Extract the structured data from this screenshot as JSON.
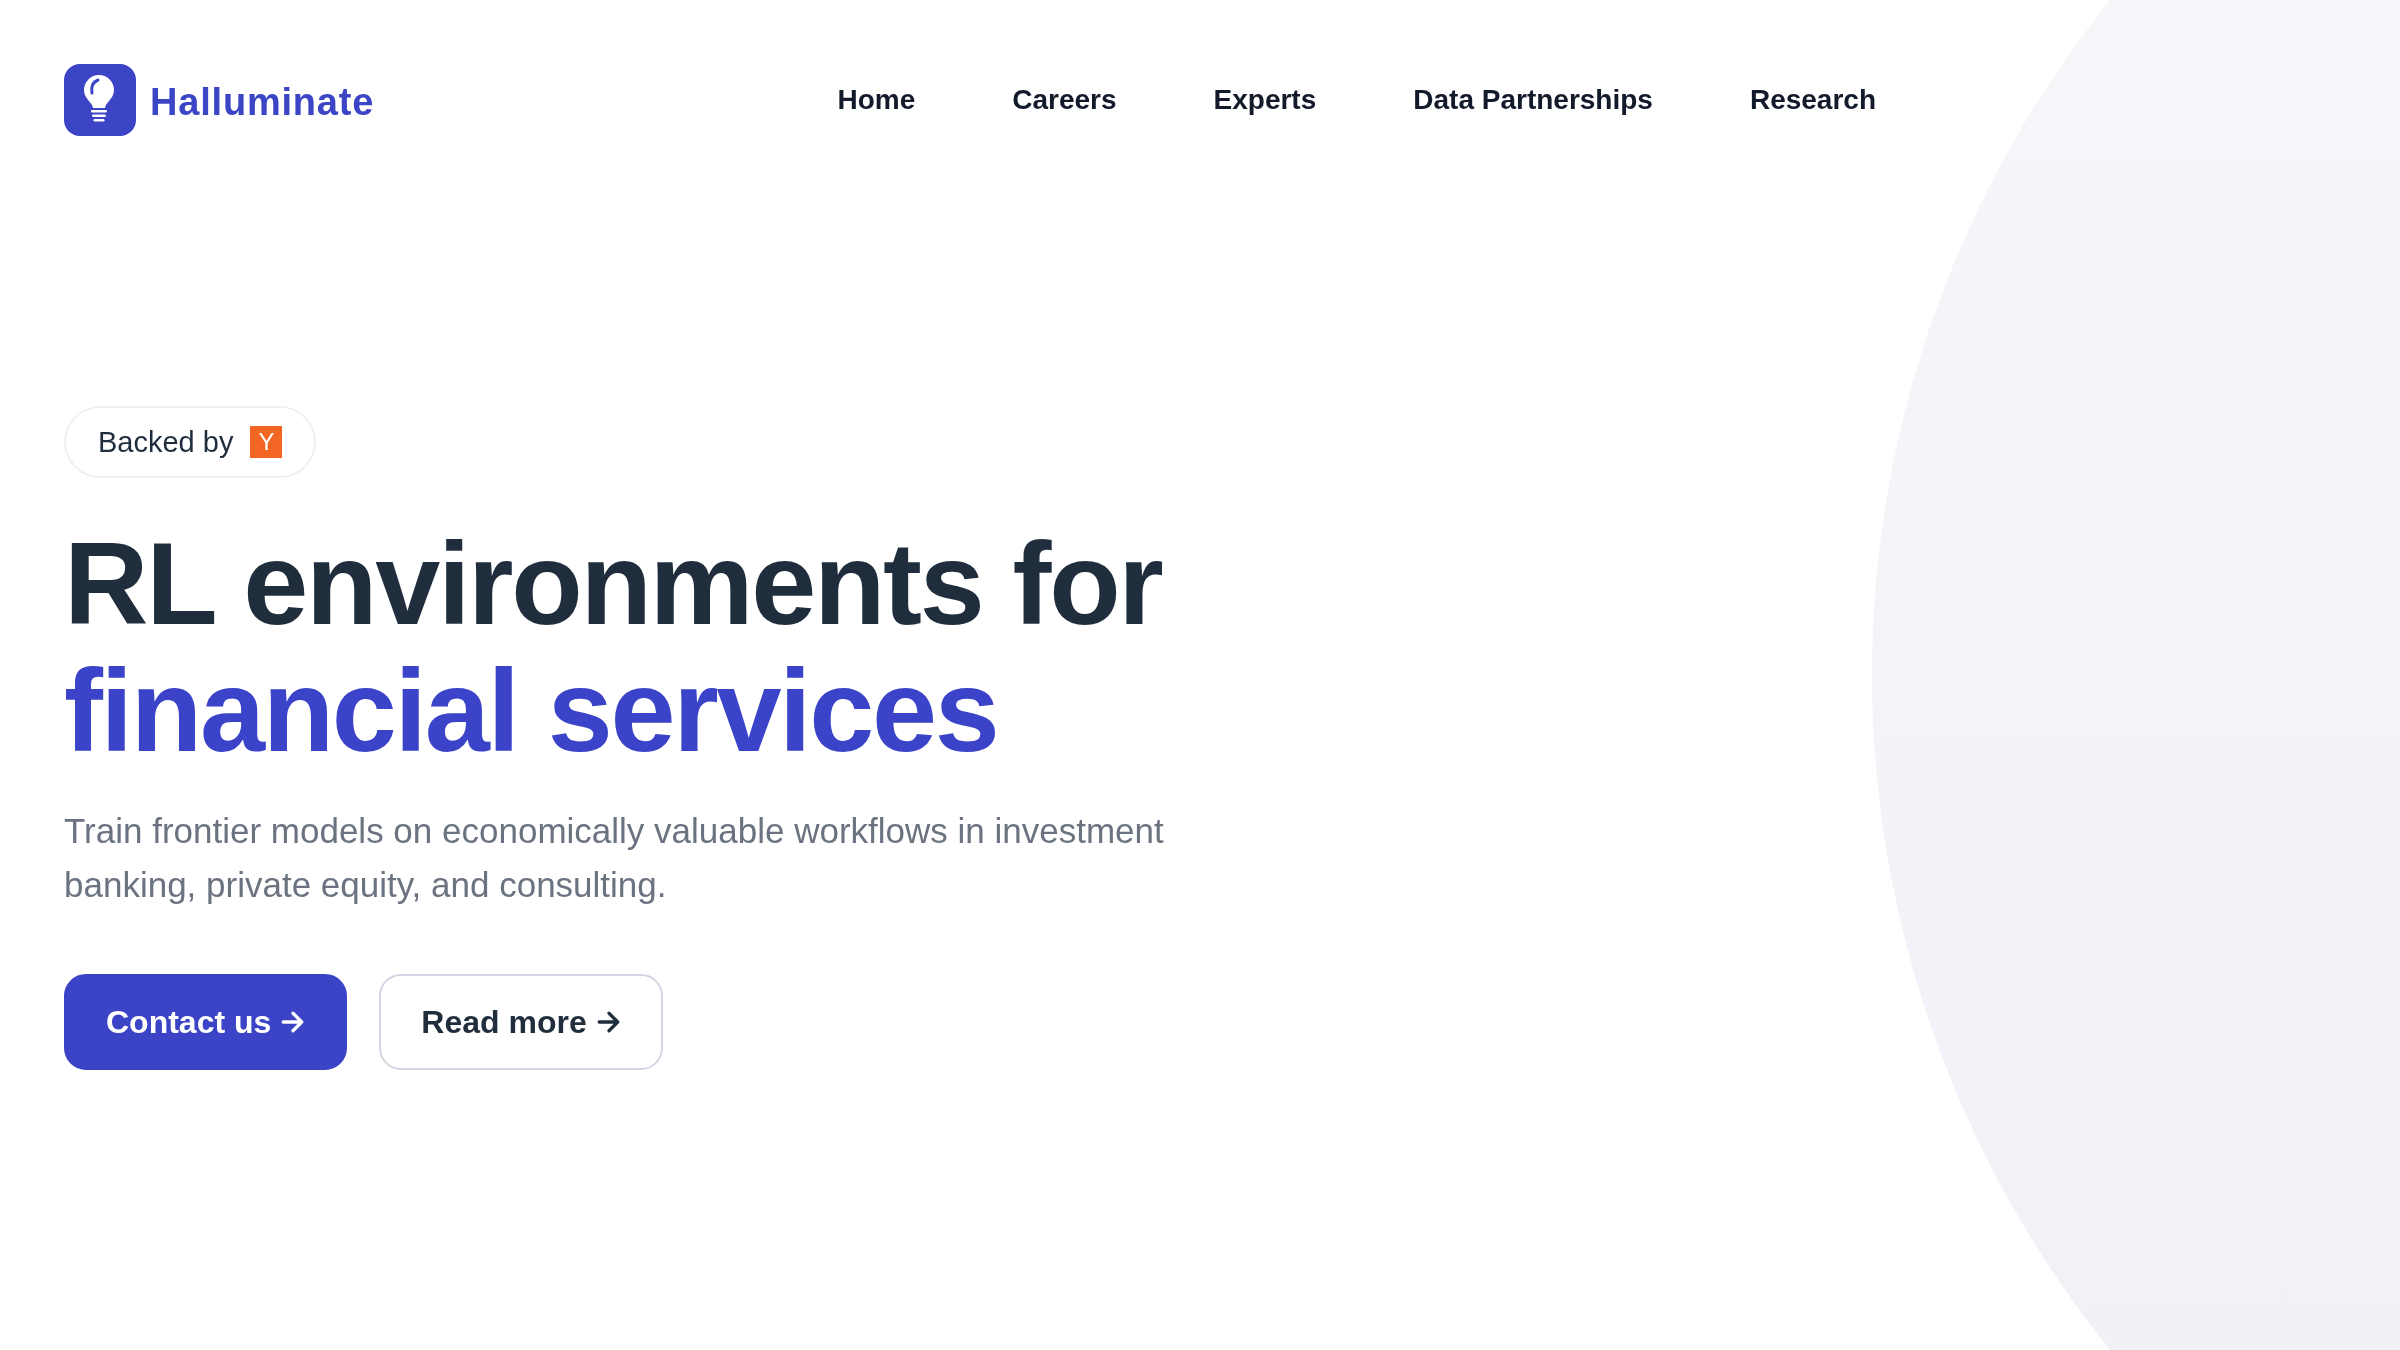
{
  "header": {
    "logo": {
      "name": "Halluminate"
    },
    "nav": [
      {
        "label": "Home"
      },
      {
        "label": "Careers"
      },
      {
        "label": "Experts"
      },
      {
        "label": "Data Partnerships"
      },
      {
        "label": "Research"
      }
    ]
  },
  "hero": {
    "badge": {
      "label": "Backed by",
      "logo_letter": "Y"
    },
    "headline": {
      "text": "RL environments for",
      "highlight": "financial services"
    },
    "description": "Train frontier models on economically valuable workflows in investment banking, private equity, and consulting.",
    "buttons": [
      {
        "label": "Contact us",
        "kind": "primary"
      },
      {
        "label": "Read more",
        "kind": "secondary"
      }
    ]
  }
}
